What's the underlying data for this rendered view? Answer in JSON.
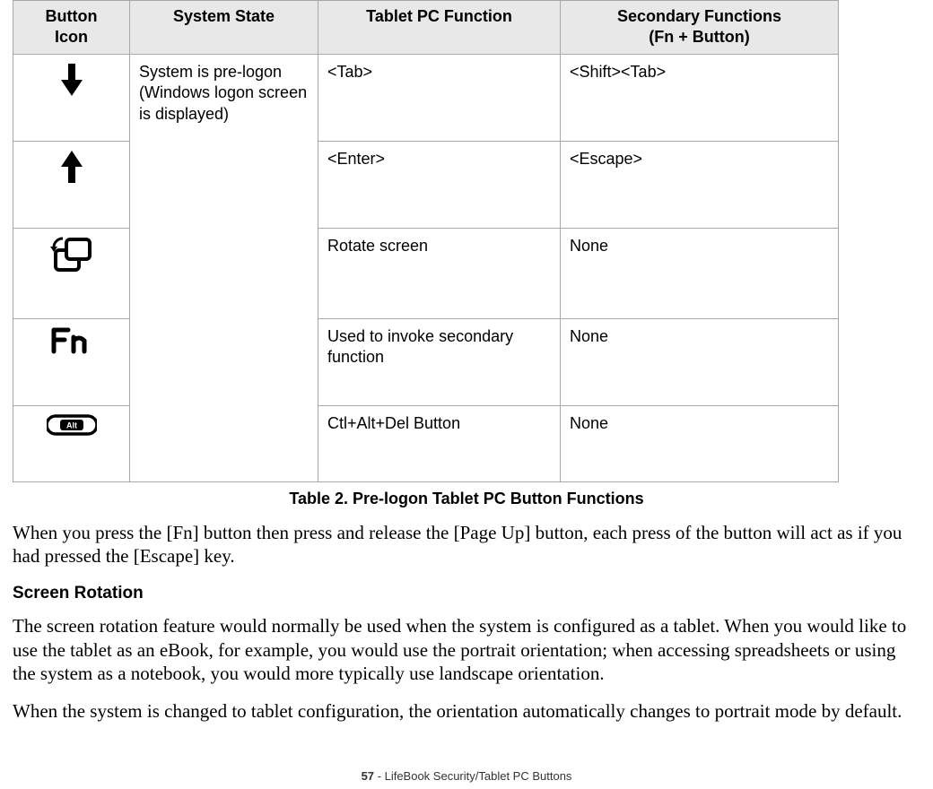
{
  "table": {
    "headers": {
      "col1a": "Button",
      "col1b": "Icon",
      "col2": "System State",
      "col3": "Tablet PC Function",
      "col4a": "Secondary Functions",
      "col4b": "(Fn + Button)"
    },
    "state": "System is pre-logon (Windows logon screen is displayed)",
    "rows": [
      {
        "func": "<Tab>",
        "secondary": "<Shift><Tab>"
      },
      {
        "func": "<Enter>",
        "secondary": "<Escape>"
      },
      {
        "func": "Rotate screen",
        "secondary": "None"
      },
      {
        "func": "Used to invoke secondary function",
        "secondary": "None"
      },
      {
        "func": "Ctl+Alt+Del Button",
        "secondary": "None"
      }
    ],
    "caption": "Table 2.  Pre-logon Tablet PC Button Functions"
  },
  "paragraphs": {
    "p1": "When you press the [Fn] button then press and release the [Page Up] button, each press of the button will act as if you had pressed the [Escape] key.",
    "heading": "Screen Rotation",
    "p2": "The screen rotation feature would normally be used when the system is configured as a tablet. When you would like to use the tablet as an eBook, for example, you would use the portrait orientation; when accessing spreadsheets or using the system as a notebook, you would more typically use landscape orientation.",
    "p3": "When the system is changed to tablet configuration, the orientation automatically changes to portrait mode by default."
  },
  "footer": {
    "pagenum": "57",
    "sep": " - ",
    "title": "LifeBook Security/Tablet PC Buttons"
  }
}
